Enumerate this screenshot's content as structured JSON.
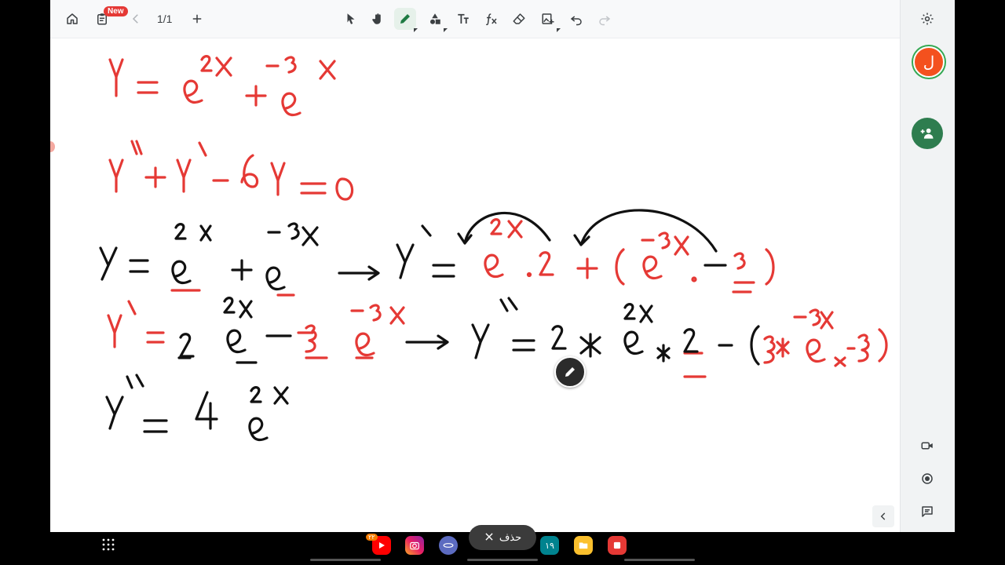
{
  "toolbar": {
    "new_badge": "New",
    "page_indicator": "1/1",
    "icons": [
      "home-icon",
      "clipboard-icon",
      "chevron-left-icon",
      "plus-icon",
      "select-arrow-icon",
      "hand-icon",
      "pen-icon",
      "shapes-icon",
      "text-icon",
      "formula-icon",
      "eraser-icon",
      "image-icon",
      "undo-icon",
      "redo-icon",
      "settings-icon"
    ]
  },
  "right_rail": {
    "avatar_initial": "ل",
    "icons": [
      "add-people-icon",
      "video-icon",
      "record-icon",
      "chat-icon",
      "chevron-left-icon"
    ]
  },
  "taskbar": {
    "toast_label": "حذف",
    "youtube_badge": "٢٢",
    "calendar_label": "١٩"
  },
  "colors": {
    "ink_red": "#e53935",
    "ink_black": "#111111",
    "accent_green": "#2e7d4f"
  }
}
